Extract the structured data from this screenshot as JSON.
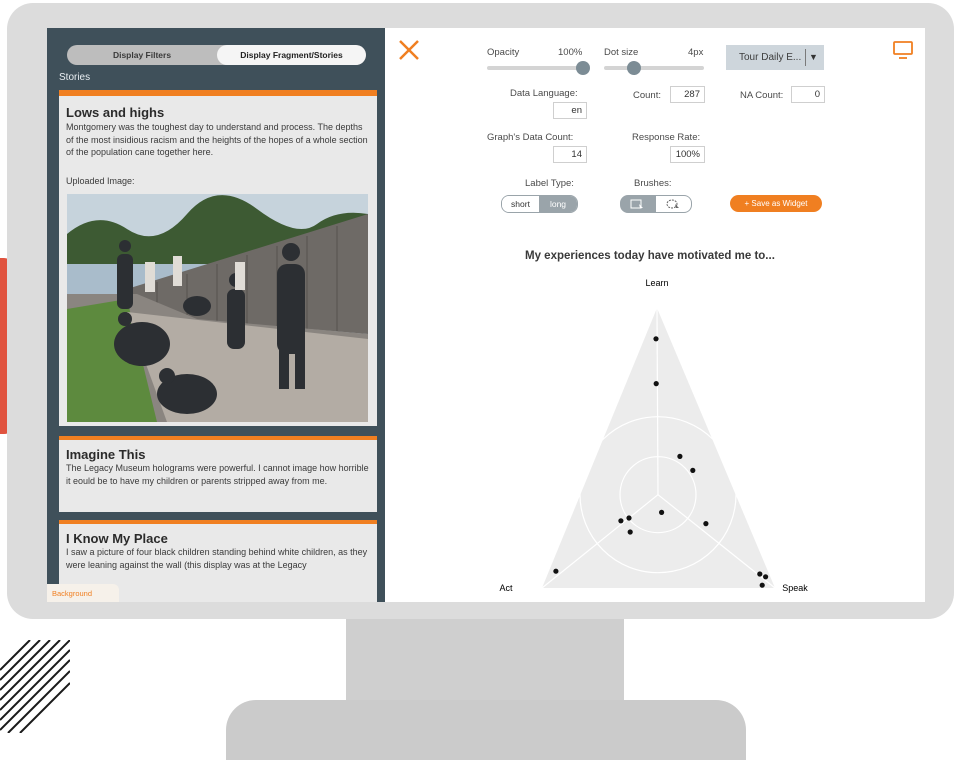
{
  "left_panel": {
    "toggle": {
      "filters": "Display Filters",
      "stories": "Display Fragment/Stories"
    },
    "section_label": "Stories",
    "stories": [
      {
        "title": "Lows and highs",
        "text": "Montgomery was the toughest day to understand and process. The depths of the most insidious racism and the heights of the hopes of a whole section of the population cane together here.",
        "uploaded_label": "Uploaded Image:"
      },
      {
        "title": "Imagine This",
        "text": "The Legacy Museum holograms were powerful. I cannot image how horrible it eould be to have my children or parents stripped away from me."
      },
      {
        "title": "I Know My Place",
        "text": "I saw a picture of four black children standing behind white children, as they were leaning against the wall (this display was at the Legacy"
      }
    ],
    "background_tab": "Background"
  },
  "controls": {
    "opacity": {
      "label": "Opacity",
      "value": "100%",
      "fraction": 1.0
    },
    "dot_size": {
      "label": "Dot size",
      "value": "4px",
      "fraction": 0.3
    },
    "dropdown": "Tour Daily E...",
    "data_language": {
      "label": "Data Language:",
      "value": "en"
    },
    "count": {
      "label": "Count:",
      "value": "287"
    },
    "na_count": {
      "label": "NA Count:",
      "value": "0"
    },
    "graph_data_count": {
      "label": "Graph's Data Count:",
      "value": "14"
    },
    "response_rate": {
      "label": "Response Rate:",
      "value": "100%"
    },
    "label_type": {
      "label": "Label Type:",
      "options": [
        "short",
        "long"
      ],
      "selected": "short"
    },
    "brushes": {
      "label": "Brushes:"
    },
    "save_widget": "+ Save as Widget"
  },
  "chart_data": {
    "type": "scatter",
    "subtype": "ternary",
    "title": "My experiences today have motivated me to...",
    "axes": {
      "top": "Learn",
      "left": "Act",
      "right": "Speak"
    },
    "points": [
      {
        "learn": 0.89,
        "act": 0.06,
        "speak": 0.05
      },
      {
        "learn": 0.73,
        "act": 0.14,
        "speak": 0.13
      },
      {
        "learn": 0.47,
        "act": 0.17,
        "speak": 0.36
      },
      {
        "learn": 0.42,
        "act": 0.14,
        "speak": 0.44
      },
      {
        "learn": 0.27,
        "act": 0.35,
        "speak": 0.38
      },
      {
        "learn": 0.24,
        "act": 0.54,
        "speak": 0.22
      },
      {
        "learn": 0.25,
        "act": 0.5,
        "speak": 0.25
      },
      {
        "learn": 0.2,
        "act": 0.52,
        "speak": 0.28
      },
      {
        "learn": 0.23,
        "act": 0.18,
        "speak": 0.59
      },
      {
        "learn": 0.06,
        "act": 0.91,
        "speak": 0.03
      },
      {
        "learn": 0.05,
        "act": 0.04,
        "speak": 0.91
      },
      {
        "learn": 0.04,
        "act": 0.02,
        "speak": 0.94
      },
      {
        "learn": 0.01,
        "act": 0.05,
        "speak": 0.94
      }
    ]
  },
  "colors": {
    "accent": "#f07f21",
    "panel": "#3f505a"
  }
}
